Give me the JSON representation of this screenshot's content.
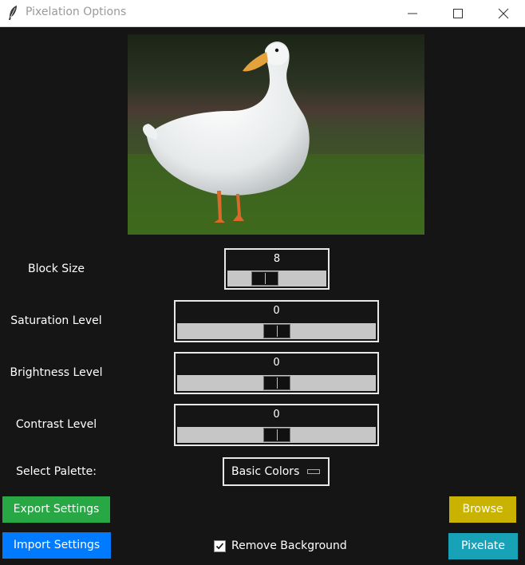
{
  "window": {
    "title": "Pixelation Options"
  },
  "preview": {
    "description_icon": "duck-photo"
  },
  "controls": {
    "block_size": {
      "label": "Block Size",
      "value": "8",
      "level": 0.33
    },
    "saturation": {
      "label": "Saturation Level",
      "value": "0",
      "level": 0.5
    },
    "brightness": {
      "label": "Brightness Level",
      "value": "0",
      "level": 0.5
    },
    "contrast": {
      "label": "Contrast Level",
      "value": "0",
      "level": 0.5
    }
  },
  "palette": {
    "label": "Select Palette:",
    "selected": "Basic Colors"
  },
  "buttons": {
    "export": "Export Settings",
    "import": "Import Settings",
    "browse": "Browse",
    "pixelate": "Pixelate"
  },
  "remove_background": {
    "label": "Remove Background",
    "checked": true
  },
  "colors": {
    "export": "#28a745",
    "import": "#007bff",
    "browse": "#c9b300",
    "pixelate": "#17a2b8"
  }
}
